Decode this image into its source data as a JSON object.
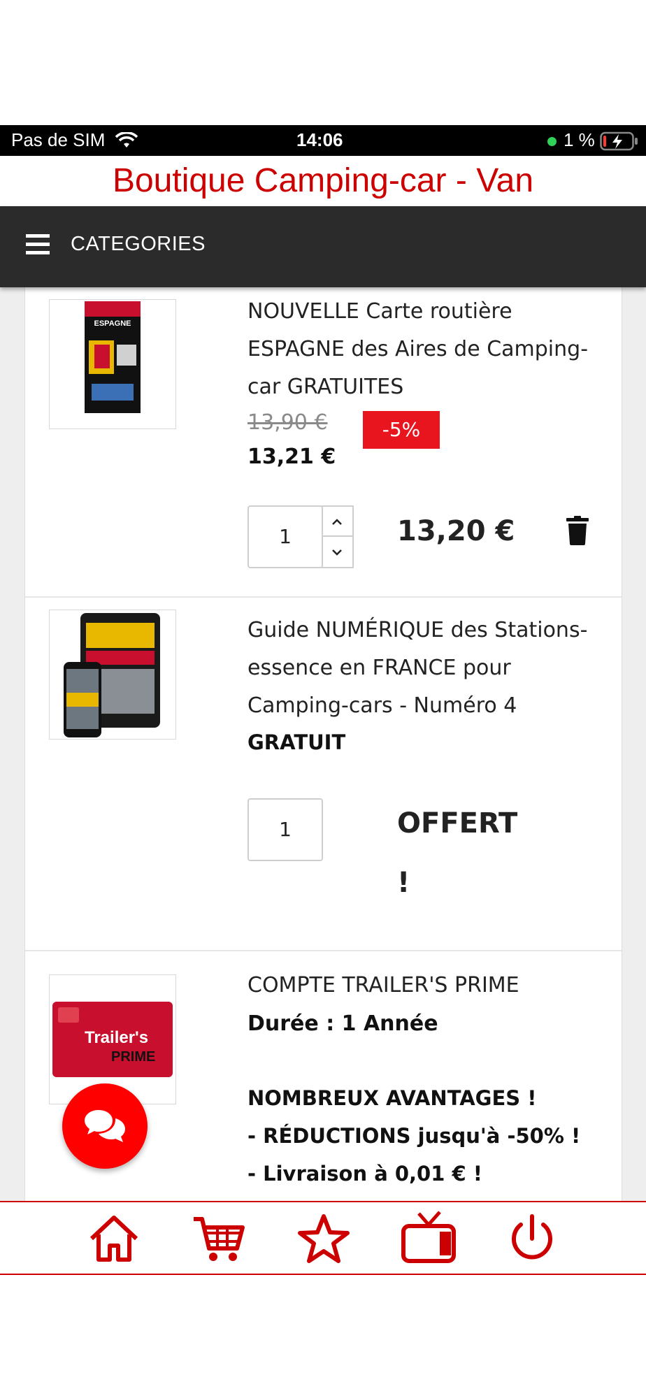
{
  "status_bar": {
    "carrier": "Pas de SIM",
    "time": "14:06",
    "battery": "1 %"
  },
  "app": {
    "title": "Boutique Camping-car - Van"
  },
  "categories_bar": {
    "label": "CATEGORIES",
    "icon": "menu-icon"
  },
  "cart_items": [
    {
      "name": "NOUVELLE Carte routière ESPAGNE des Aires de Camping-car GRATUITES",
      "old_price": "13,90 €",
      "discount": "-5%",
      "price": "13,21 €",
      "quantity": "1",
      "total": "13,20 €",
      "thumb_text": "ESPAGNE"
    },
    {
      "name": "Guide NUMÉRIQUE des Stations-essence en FRANCE pour Camping-cars - Numéro 4",
      "price": "GRATUIT",
      "quantity": "1",
      "total": "OFFERT",
      "total_suffix": "!"
    },
    {
      "name": "COMPTE TRAILER'S PRIME",
      "duration": "Durée : 1 Année",
      "advantages_title": "NOMBREUX AVANTAGES !",
      "advantage_1": "- RÉDUCTIONS jusqu'à -50% !",
      "advantage_2": "- Livraison à 0,01 € !",
      "thumb_line1": "Trailer's",
      "thumb_line2": "PRIME"
    }
  ],
  "bottom_nav": [
    {
      "icon": "home-icon"
    },
    {
      "icon": "cart-icon"
    },
    {
      "icon": "star-icon"
    },
    {
      "icon": "tv-icon"
    },
    {
      "icon": "power-icon"
    }
  ],
  "colors": {
    "brand_red": "#cc0000",
    "discount_badge": "#e8141e",
    "category_bar": "#2b2b2b"
  }
}
